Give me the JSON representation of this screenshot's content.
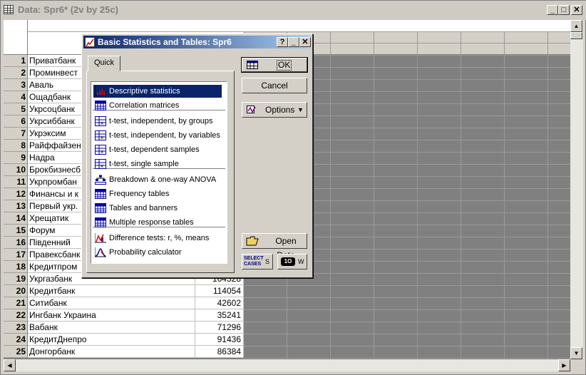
{
  "window": {
    "title": "Data: Spr6* (2v by 25c)",
    "min_label": "_",
    "max_label": "□",
    "close_label": "✕"
  },
  "rows": [
    {
      "n": "1",
      "name": "Приватбанк",
      "value": ""
    },
    {
      "n": "2",
      "name": "Проминвест",
      "value": ""
    },
    {
      "n": "3",
      "name": "Аваль",
      "value": ""
    },
    {
      "n": "4",
      "name": "Ощадбанк",
      "value": ""
    },
    {
      "n": "5",
      "name": "Укрсоцбанк",
      "value": ""
    },
    {
      "n": "6",
      "name": "Укрсиббанк",
      "value": ""
    },
    {
      "n": "7",
      "name": "Укрэксим",
      "value": ""
    },
    {
      "n": "8",
      "name": "Райффайзен",
      "value": ""
    },
    {
      "n": "9",
      "name": "Надра",
      "value": ""
    },
    {
      "n": "10",
      "name": "Брокбизнесб",
      "value": ""
    },
    {
      "n": "11",
      "name": "Укрпромбан",
      "value": ""
    },
    {
      "n": "12",
      "name": "Финансы и к",
      "value": ""
    },
    {
      "n": "13",
      "name": "Первый укр.",
      "value": ""
    },
    {
      "n": "14",
      "name": "Хрещатик",
      "value": ""
    },
    {
      "n": "15",
      "name": "Форум",
      "value": ""
    },
    {
      "n": "16",
      "name": "Південний",
      "value": ""
    },
    {
      "n": "17",
      "name": "Правексбанк",
      "value": ""
    },
    {
      "n": "18",
      "name": "Кредитпром",
      "value": ""
    },
    {
      "n": "19",
      "name": "Укргазбанк",
      "value": "164328"
    },
    {
      "n": "20",
      "name": "Кредитбанк",
      "value": "114054"
    },
    {
      "n": "21",
      "name": "Ситибанк",
      "value": "42602"
    },
    {
      "n": "22",
      "name": "Ингбанк Украина",
      "value": "35241"
    },
    {
      "n": "23",
      "name": "Вабанк",
      "value": "71296"
    },
    {
      "n": "24",
      "name": "КредитДнепро",
      "value": "91436"
    },
    {
      "n": "25",
      "name": "Донгорбанк",
      "value": "86384"
    }
  ],
  "dialog": {
    "title": "Basic Statistics and Tables: Spr6",
    "help_label": "?",
    "min_label": "_",
    "close_label": "✕",
    "tab": "Quick",
    "items": [
      {
        "label": "Descriptive statistics",
        "icon": "descriptive-stats-icon"
      },
      {
        "label": "Correlation matrices",
        "icon": "correlation-matrix-icon"
      },
      {
        "label": "t-test, independent, by groups",
        "icon": "ttest-groups-icon"
      },
      {
        "label": "t-test, independent, by variables",
        "icon": "ttest-variables-icon"
      },
      {
        "label": "t-test, dependent samples",
        "icon": "ttest-dependent-icon"
      },
      {
        "label": "t-test, single sample",
        "icon": "ttest-single-icon"
      },
      {
        "label": "Breakdown & one-way ANOVA",
        "icon": "breakdown-anova-icon"
      },
      {
        "label": "Frequency tables",
        "icon": "frequency-tables-icon"
      },
      {
        "label": "Tables and banners",
        "icon": "tables-banners-icon"
      },
      {
        "label": "Multiple response tables",
        "icon": "multiple-response-icon"
      },
      {
        "label": "Difference tests: r, %, means",
        "icon": "difference-tests-icon"
      },
      {
        "label": "Probability calculator",
        "icon": "probability-calculator-icon"
      }
    ],
    "ok_label": "OK",
    "cancel_label": "Cancel",
    "options_label": "Options",
    "open_data_label": "Open Data",
    "select_cases_line1": "SELECT",
    "select_cases_line2": "CASES",
    "select_cases_key": "S",
    "weight_key": "W",
    "weight_icon_text": "1O"
  }
}
